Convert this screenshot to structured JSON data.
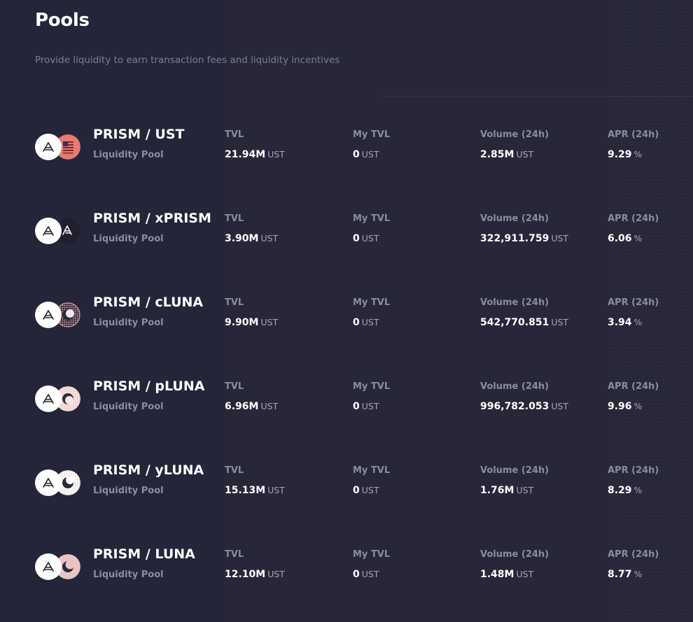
{
  "page": {
    "title": "Pools",
    "subtitle": "Provide liquidity to earn transaction fees and liquidity incentives"
  },
  "colors": {
    "background": "#272739",
    "label": "#8b8ba2",
    "ust_icon": "#e77b72",
    "luna_icon": "#e8b4b0"
  },
  "column_labels": {
    "tvl": "TVL",
    "my_tvl": "My TVL",
    "volume": "Volume (24h)",
    "apr": "APR (24h)"
  },
  "pools": [
    {
      "name": "PRISM / UST",
      "type": "Liquidity Pool",
      "icon_a": "prism-icon",
      "icon_b": "ust-icon",
      "tvl": "21.94M",
      "tvl_unit": "UST",
      "my_tvl": "0",
      "my_tvl_unit": "UST",
      "volume": "2.85M",
      "volume_unit": "UST",
      "apr": "9.29",
      "apr_unit": "%"
    },
    {
      "name": "PRISM / xPRISM",
      "type": "Liquidity Pool",
      "icon_a": "prism-icon",
      "icon_b": "xprism-icon",
      "tvl": "3.90M",
      "tvl_unit": "UST",
      "my_tvl": "0",
      "my_tvl_unit": "UST",
      "volume": "322,911.759",
      "volume_unit": "UST",
      "apr": "6.06",
      "apr_unit": "%"
    },
    {
      "name": "PRISM / cLUNA",
      "type": "Liquidity Pool",
      "icon_a": "prism-icon",
      "icon_b": "cluna-icon",
      "tvl": "9.90M",
      "tvl_unit": "UST",
      "my_tvl": "0",
      "my_tvl_unit": "UST",
      "volume": "542,770.851",
      "volume_unit": "UST",
      "apr": "3.94",
      "apr_unit": "%"
    },
    {
      "name": "PRISM / pLUNA",
      "type": "Liquidity Pool",
      "icon_a": "prism-icon",
      "icon_b": "pluna-icon",
      "tvl": "6.96M",
      "tvl_unit": "UST",
      "my_tvl": "0",
      "my_tvl_unit": "UST",
      "volume": "996,782.053",
      "volume_unit": "UST",
      "apr": "9.96",
      "apr_unit": "%"
    },
    {
      "name": "PRISM / yLUNA",
      "type": "Liquidity Pool",
      "icon_a": "prism-icon",
      "icon_b": "yluna-icon",
      "tvl": "15.13M",
      "tvl_unit": "UST",
      "my_tvl": "0",
      "my_tvl_unit": "UST",
      "volume": "1.76M",
      "volume_unit": "UST",
      "apr": "8.29",
      "apr_unit": "%"
    },
    {
      "name": "PRISM / LUNA",
      "type": "Liquidity Pool",
      "icon_a": "prism-icon",
      "icon_b": "luna-icon",
      "tvl": "12.10M",
      "tvl_unit": "UST",
      "my_tvl": "0",
      "my_tvl_unit": "UST",
      "volume": "1.48M",
      "volume_unit": "UST",
      "apr": "8.77",
      "apr_unit": "%"
    }
  ]
}
